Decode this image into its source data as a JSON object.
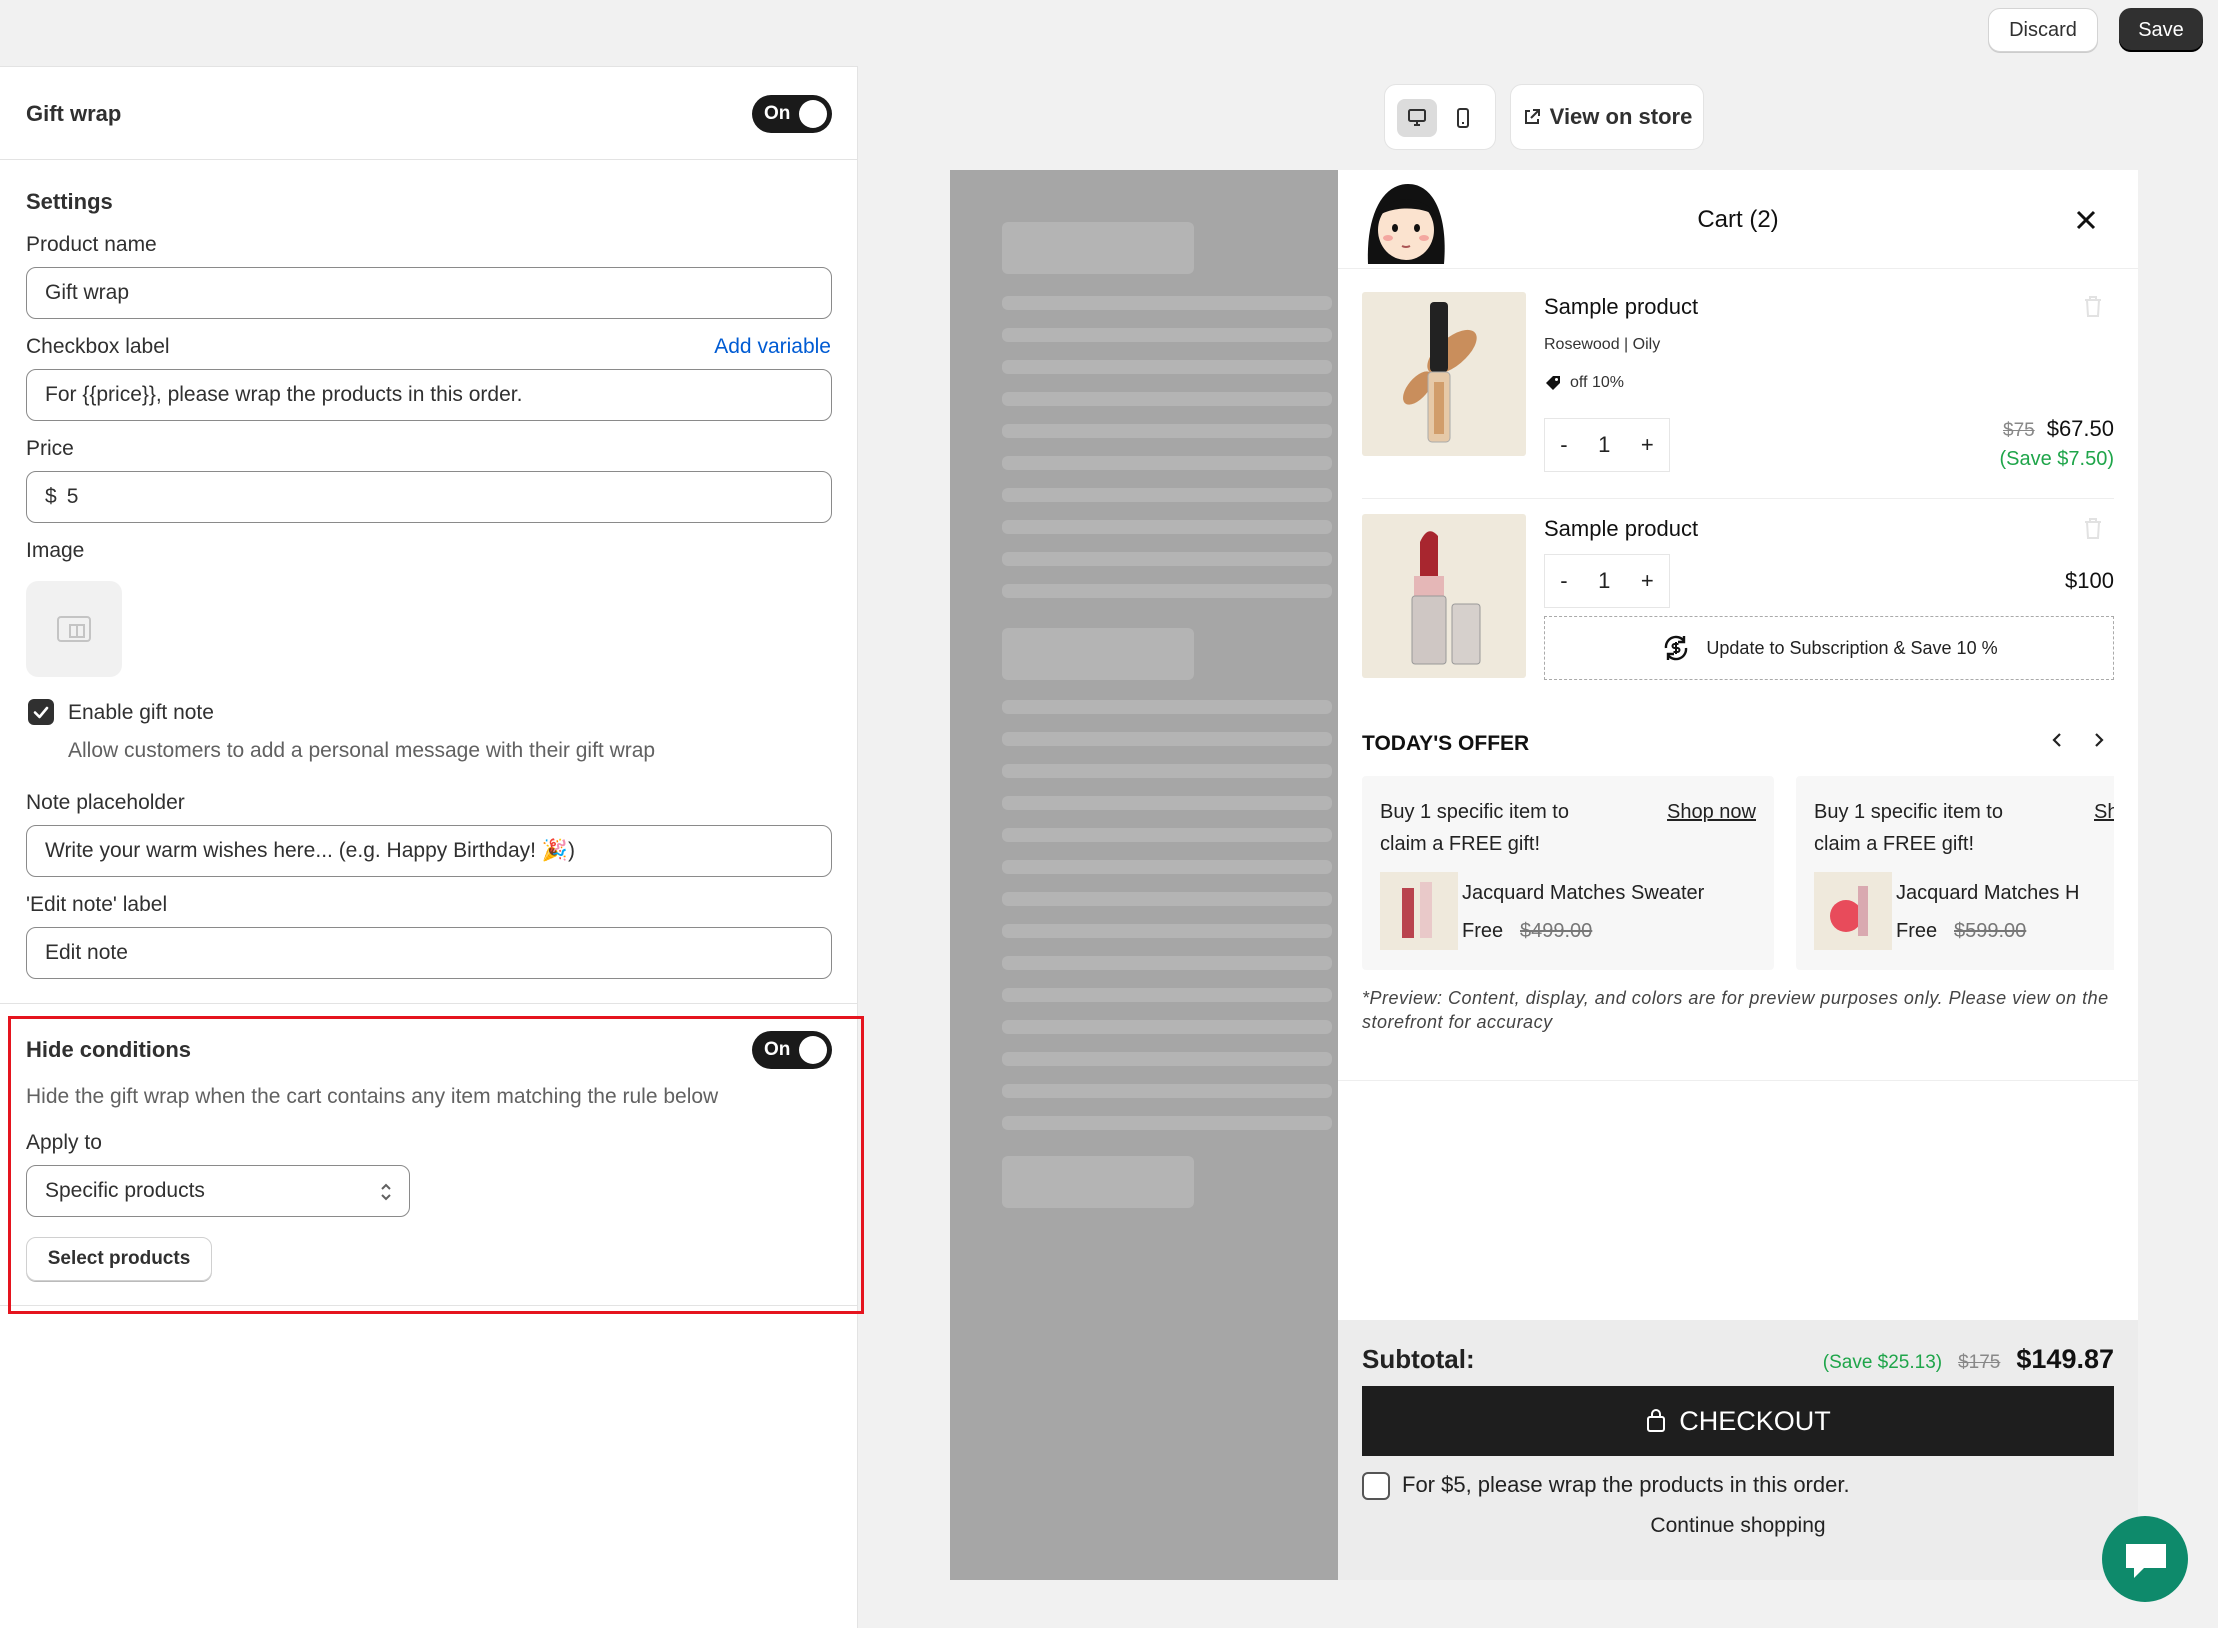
{
  "topbar": {
    "discard_label": "Discard",
    "save_label": "Save"
  },
  "gift_wrap": {
    "title": "Gift wrap",
    "toggle_label": "On"
  },
  "settings": {
    "heading": "Settings",
    "product_name_label": "Product name",
    "product_name_value": "Gift wrap",
    "checkbox_label_label": "Checkbox label",
    "add_variable_link": "Add variable",
    "checkbox_label_value": "For {{price}}, please wrap the products in this order.",
    "price_label": "Price",
    "price_currency": "$",
    "price_value": "5",
    "image_label": "Image",
    "enable_gift_note_label": "Enable gift note",
    "enable_gift_note_help": "Allow customers to add a personal message with their gift wrap",
    "note_placeholder_label": "Note placeholder",
    "note_placeholder_value": "Write your warm wishes here... (e.g. Happy Birthday! 🎉)",
    "edit_note_label_label": "'Edit note' label",
    "edit_note_label_value": "Edit note"
  },
  "hide_conditions": {
    "title": "Hide conditions",
    "toggle_label": "On",
    "description": "Hide the gift wrap when the cart contains any item matching the rule below",
    "apply_to_label": "Apply to",
    "apply_to_value": "Specific products",
    "select_products_button": "Select products",
    "highlight_color": "#e5141e"
  },
  "preview": {
    "view_on_store": "View on store",
    "cart_title": "Cart (2)",
    "items": [
      {
        "name": "Sample product",
        "variant": "Rosewood | Oily",
        "discount": "off 10%",
        "qty": "1",
        "compare_price": "$75",
        "price": "$67.50",
        "save": "(Save $7.50)"
      },
      {
        "name": "Sample product",
        "qty": "1",
        "price": "$100",
        "subscription": "Update to Subscription & Save 10 %"
      }
    ],
    "offer_heading": "TODAY'S OFFER",
    "offers": [
      {
        "headline": "Buy 1 specific item to claim a FREE gift!",
        "cta": "Shop now",
        "product": "Jacquard Matches Sweater",
        "price": "Free",
        "compare_price": "$499.00"
      },
      {
        "headline": "Buy 1 specific item to claim a FREE gift!",
        "cta": "Sh",
        "product": "Jacquard Matches H",
        "price": "Free",
        "compare_price": "$599.00"
      }
    ],
    "preview_note": "*Preview: Content, display, and colors are for preview purposes only. Please view on the storefront for accuracy",
    "subtotal_label": "Subtotal:",
    "subtotal_save": "(Save $25.13)",
    "subtotal_compare": "$175",
    "subtotal_value": "$149.87",
    "checkout_label": "CHECKOUT",
    "gift_wrap_checkbox": "For $5, please wrap the products in this order.",
    "continue_shopping": "Continue shopping",
    "qty_minus": "-",
    "qty_plus": "+",
    "save_color": "#1fa54a"
  }
}
